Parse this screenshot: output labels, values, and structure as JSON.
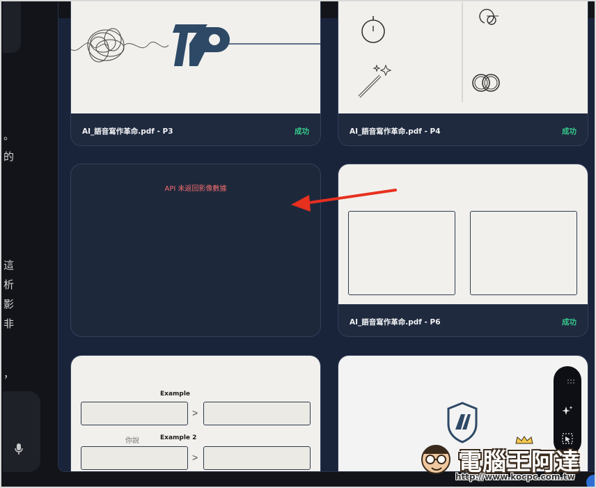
{
  "chat": {
    "text_lines": [
      "。",
      "的",
      "",
      "",
      "",
      "",
      "",
      "",
      "",
      "",
      "",
      "",
      "",
      "",
      "",
      "",
      "",
      "",
      "",
      "",
      "",
      "",
      "",
      "",
      "",
      "",
      "",
      "",
      "",
      "",
      "",
      "",
      "",
      "",
      "",
      "",
      "",
      ""
    ],
    "fragments": [
      "。",
      "的",
      "這",
      "析",
      "影",
      "非",
      "，"
    ]
  },
  "cards": [
    {
      "name": "AI_語音寫作革命.pdf - P3",
      "status": "成功"
    },
    {
      "name": "AI_語音寫作革命.pdf - P4",
      "status": "成功"
    },
    {
      "error": "API 未返回影像數據"
    },
    {
      "name": "AI_語音寫作革命.pdf - P6",
      "status": "成功"
    }
  ],
  "slide_p7": {
    "example_1": "Example",
    "example_2": "Example 2",
    "you_say": "你說",
    "arrow": ">"
  },
  "watermark": {
    "brand": "電腦王阿達",
    "url": "http://www.kocpc.com.tw"
  },
  "colors": {
    "success": "#35c98a",
    "error": "#f26d6d",
    "annotation_arrow": "#e8301f",
    "panel": "#19233a"
  },
  "icons": [
    "microphone-icon",
    "grip-icon",
    "sparkle-icon",
    "select-region-icon"
  ]
}
